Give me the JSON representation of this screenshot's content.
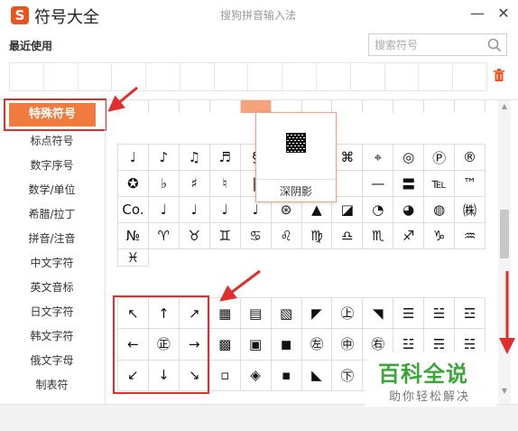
{
  "app": {
    "logo_letter": "S",
    "title": "符号大全",
    "subtitle": "搜狗拼音输入法",
    "minimize_label": "—",
    "close_label": "✕"
  },
  "recent": {
    "label": "最近使用",
    "cell_count": 14
  },
  "search": {
    "placeholder": "搜索符号",
    "value": ""
  },
  "sidebar": {
    "items": [
      {
        "label": "特殊符号",
        "active": true
      },
      {
        "label": "标点符号"
      },
      {
        "label": "数字序号"
      },
      {
        "label": "数学/单位"
      },
      {
        "label": "希腊/拉丁"
      },
      {
        "label": "拼音/注音"
      },
      {
        "label": "中文字符"
      },
      {
        "label": "英文音标"
      },
      {
        "label": "日文字符"
      },
      {
        "label": "韩文字符"
      },
      {
        "label": "俄文字母"
      },
      {
        "label": "制表符"
      }
    ]
  },
  "tooltip": {
    "name": "深阴影",
    "symbol": "shade-dark"
  },
  "upper_grid": {
    "rows": [
      [
        "♩",
        "♪",
        "♫",
        "♬",
        "§",
        "",
        "",
        "⌘",
        "⌖",
        "◎",
        "Ⓟ",
        "®",
        "✪"
      ],
      [
        "♭",
        "♯",
        "♮",
        "‖",
        "",
        "",
        "",
        "—",
        "〓",
        "℡",
        "™",
        "Co."
      ],
      [
        "♩",
        "♩",
        "♩",
        "♩",
        "⊛",
        "▲",
        "◪",
        "◔",
        "◕",
        "◍",
        "㈱",
        "№"
      ],
      [
        "♈",
        "♉",
        "♊",
        "♋",
        "♌",
        "♍",
        "♎",
        "♏",
        "♐",
        "♑",
        "♒",
        "♓"
      ]
    ]
  },
  "lower_grid": {
    "rows": [
      [
        "↖",
        "↑",
        "↗",
        "▦",
        "▤",
        "▧",
        "◤",
        "㊤",
        "◥",
        "☰",
        "☱",
        "☲"
      ],
      [
        "←",
        "㊣",
        "→",
        "▩",
        "▣",
        "◼",
        "㊧",
        "㊥",
        "㊨",
        "☳",
        "☴",
        "☵"
      ],
      [
        "↙",
        "↓",
        "↘",
        "▫",
        "◈",
        "▪",
        "◣",
        "㊦",
        "",
        "☶",
        "☷",
        ""
      ]
    ]
  },
  "watermark": {
    "brand": "百科全说",
    "slogan": "助你轻松解决"
  },
  "colors": {
    "accent": "#f07b3f",
    "annotation": "#e02d2d",
    "logo": "#e8541e",
    "watermark": "#3ca63c"
  },
  "icons": {
    "search": "search-icon",
    "trash": "trash-icon"
  }
}
